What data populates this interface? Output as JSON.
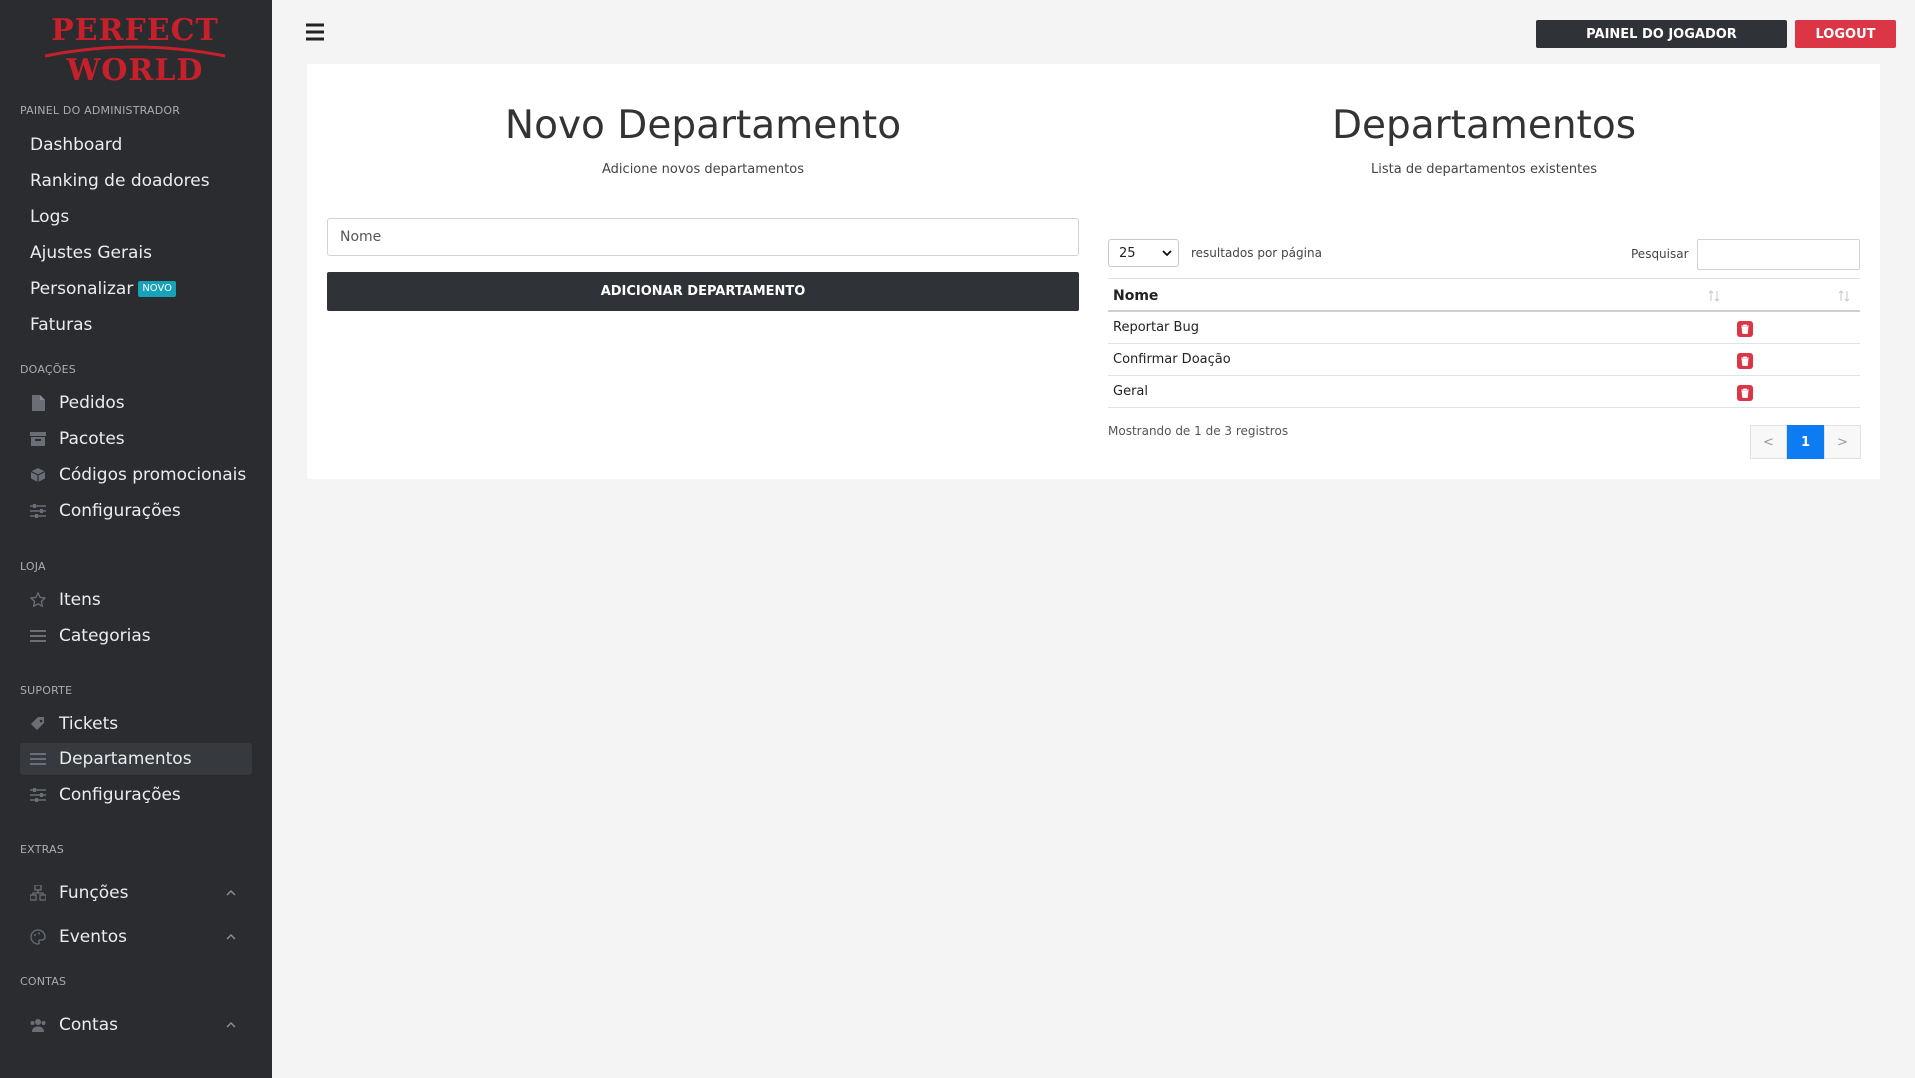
{
  "brand": {
    "line1": "PERFECT",
    "line2": "WORLD",
    "color": "#c8202a"
  },
  "sidebar": {
    "admin_section": "PAINEL DO ADMINISTRADOR",
    "admin_items": [
      {
        "label": "Dashboard"
      },
      {
        "label": "Ranking de doadores"
      },
      {
        "label": "Logs"
      },
      {
        "label": "Ajustes Gerais"
      },
      {
        "label": "Personalizar",
        "badge": "NOVO"
      },
      {
        "label": "Faturas"
      }
    ],
    "donations_section": "DOAÇÕES",
    "donations_items": [
      {
        "label": "Pedidos",
        "icon": "file-icon"
      },
      {
        "label": "Pacotes",
        "icon": "archive-icon"
      },
      {
        "label": "Códigos promocionais",
        "icon": "cube-icon"
      },
      {
        "label": "Configurações",
        "icon": "sliders-icon"
      }
    ],
    "store_section": "LOJA",
    "store_items": [
      {
        "label": "Itens",
        "icon": "star-icon"
      },
      {
        "label": "Categorias",
        "icon": "list-icon"
      }
    ],
    "support_section": "SUPORTE",
    "support_items": [
      {
        "label": "Tickets",
        "icon": "ticket-icon"
      },
      {
        "label": "Departamentos",
        "icon": "list-icon",
        "active": true
      },
      {
        "label": "Configurações",
        "icon": "sliders-icon"
      }
    ],
    "extras_section": "EXTRAS",
    "extras_items": [
      {
        "label": "Funções",
        "icon": "sitemap-icon"
      },
      {
        "label": "Eventos",
        "icon": "palette-icon"
      }
    ],
    "accounts_section": "CONTAS",
    "accounts_items": [
      {
        "label": "Contas",
        "icon": "users-icon"
      }
    ]
  },
  "topbar": {
    "player_panel": "PAINEL DO JOGADOR",
    "logout": "LOGOUT",
    "logout_color": "#dc3545"
  },
  "new_department": {
    "title": "Novo Departamento",
    "subtitle": "Adicione novos departamentos",
    "name_placeholder": "Nome",
    "add_button": "ADICIONAR DEPARTAMENTO"
  },
  "departments": {
    "title": "Departamentos",
    "subtitle": "Lista de departamentos existentes",
    "per_page_value": "25",
    "per_page_label": "resultados por página",
    "search_label": "Pesquisar",
    "column_name": "Nome",
    "rows": [
      {
        "name": "Reportar Bug"
      },
      {
        "name": "Confirmar Doação"
      },
      {
        "name": "Geral"
      }
    ],
    "info": "Mostrando de 1 de 3 registros",
    "pager": {
      "prev": "<",
      "current": "1",
      "next": ">"
    }
  }
}
